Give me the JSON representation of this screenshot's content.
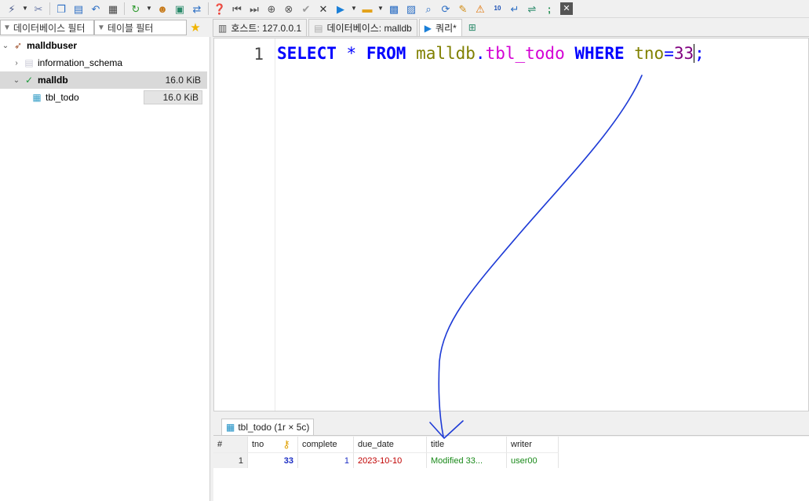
{
  "toolbar": {
    "icons": [
      "connect-icon",
      "dropdown-icon",
      "disconnect-icon",
      "copy-icon",
      "paste-icon",
      "undo-icon",
      "print-icon",
      "refresh-icon",
      "dropdown-icon",
      "user-manager-icon",
      "export-icon",
      "transfer-icon",
      "help-icon",
      "first-icon",
      "last-icon",
      "add-icon",
      "stop-icon",
      "check-icon",
      "cancel-icon",
      "run-icon",
      "dropdown-icon",
      "folder-icon",
      "dropdown-icon",
      "save-icon",
      "save-as-icon",
      "search-icon",
      "replace-icon",
      "clean-icon",
      "warning-icon",
      "binary-icon",
      "wrap-icon",
      "sync-icon",
      "semicolon-icon",
      "close-icon"
    ]
  },
  "filters": {
    "database_filter": "데이터베이스 필터",
    "table_filter": "테이블 필터"
  },
  "tree": {
    "root": "malldbuser",
    "items": [
      {
        "label": "information_schema",
        "size": ""
      },
      {
        "label": "malldb",
        "size": "16.0 KiB"
      },
      {
        "label": "tbl_todo",
        "size": "16.0 KiB"
      }
    ]
  },
  "tabs": {
    "host": "호스트: 127.0.0.1",
    "database": "데이터베이스: malldb",
    "query": "쿼리*"
  },
  "editor": {
    "line_number": "1",
    "tokens": {
      "select": "SELECT",
      "star": "*",
      "from": "FROM",
      "schema": "malldb",
      "dot": ".",
      "table": "tbl_todo",
      "where": "WHERE",
      "column": "tno",
      "equals": "=",
      "value": "33",
      "semicolon": ";"
    }
  },
  "result": {
    "tab_label": "tbl_todo (1r × 5c)",
    "columns": [
      "#",
      "tno",
      "complete",
      "due_date",
      "title",
      "writer"
    ],
    "rows": [
      {
        "num": "1",
        "tno": "33",
        "complete": "1",
        "due_date": "2023-10-10",
        "title": "Modified 33...",
        "writer": "user00"
      }
    ]
  },
  "colors": {
    "keyword": "#0000ff",
    "table": "#d400d4",
    "schema": "#808000",
    "number": "#800080",
    "annotation": "#1e3bd6"
  }
}
